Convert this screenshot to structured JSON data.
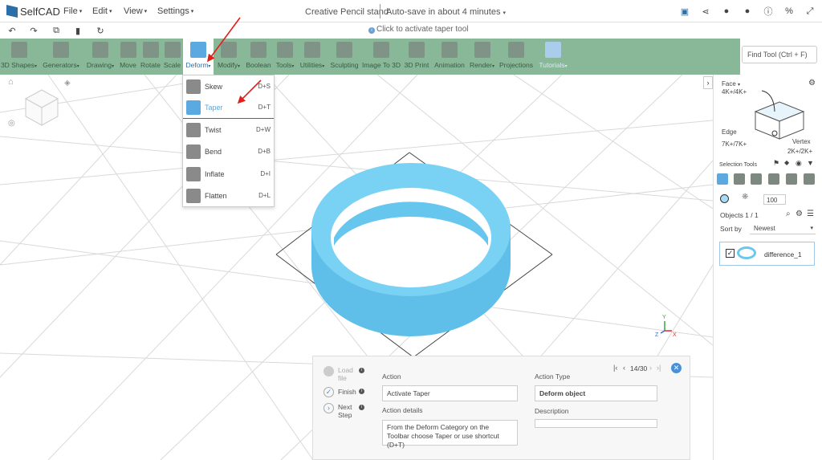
{
  "app": {
    "name": "SelfCAD"
  },
  "menus": [
    {
      "label": "File"
    },
    {
      "label": "Edit"
    },
    {
      "label": "View"
    },
    {
      "label": "Settings"
    }
  ],
  "document": {
    "title": "Creative Pencil stand",
    "autosave": "Auto-save in about 4 minutes"
  },
  "hint": {
    "text": "Click to activate taper tool"
  },
  "toolbar": {
    "tools": [
      {
        "label": "3D Shapes"
      },
      {
        "label": "Generators"
      },
      {
        "label": "Drawing"
      },
      {
        "label": "Move"
      },
      {
        "label": "Rotate"
      },
      {
        "label": "Scale"
      },
      {
        "label": "Deform"
      },
      {
        "label": "Modify"
      },
      {
        "label": "Boolean"
      },
      {
        "label": "Tools"
      },
      {
        "label": "Utilities"
      },
      {
        "label": "Sculpting"
      },
      {
        "label": "Image To 3D"
      },
      {
        "label": "3D Print"
      },
      {
        "label": "Animation"
      },
      {
        "label": "Render"
      },
      {
        "label": "Projections"
      },
      {
        "label": "Tutorials"
      }
    ],
    "find_placeholder": "Find Tool (Ctrl + F)"
  },
  "deform_menu": {
    "items": [
      {
        "label": "Skew",
        "shortcut": "D+S"
      },
      {
        "label": "Taper",
        "shortcut": "D+T"
      },
      {
        "label": "Twist",
        "shortcut": "D+W"
      },
      {
        "label": "Bend",
        "shortcut": "D+B"
      },
      {
        "label": "Inflate",
        "shortcut": "D+I"
      },
      {
        "label": "Flatten",
        "shortcut": "D+L"
      }
    ]
  },
  "right_panel": {
    "face_label": "Face",
    "face_count": "4K+/4K+",
    "edge_label": "Edge",
    "edge_count": "7K+/7K+",
    "vertex_label": "Vertex",
    "vertex_count": "2K+/2K+",
    "selection_tools": "Selection Tools",
    "brush_size": "100",
    "objects_label": "Objects 1 / 1",
    "sort_label": "Sort by",
    "sort_value": "Newest",
    "object_name": "difference_1"
  },
  "axes": {
    "x": "X",
    "y": "Y",
    "z": "Z"
  },
  "tutorial": {
    "load_file": "Load file",
    "finish": "Finish",
    "next_step": "Next Step",
    "progress": "14/30",
    "action_label": "Action",
    "action_value": "Activate Taper",
    "details_label": "Action details",
    "details_value": "From the Deform Category on the Toolbar choose Taper or use shortcut (D+T)",
    "type_label": "Action Type",
    "type_value": "Deform object",
    "description_label": "Description",
    "description_value": ""
  },
  "colors": {
    "toolbar_bg": "#89b898",
    "accent": "#5aa9e0",
    "object": "#6ac8ee",
    "annotation_arrow": "#e0201b"
  }
}
